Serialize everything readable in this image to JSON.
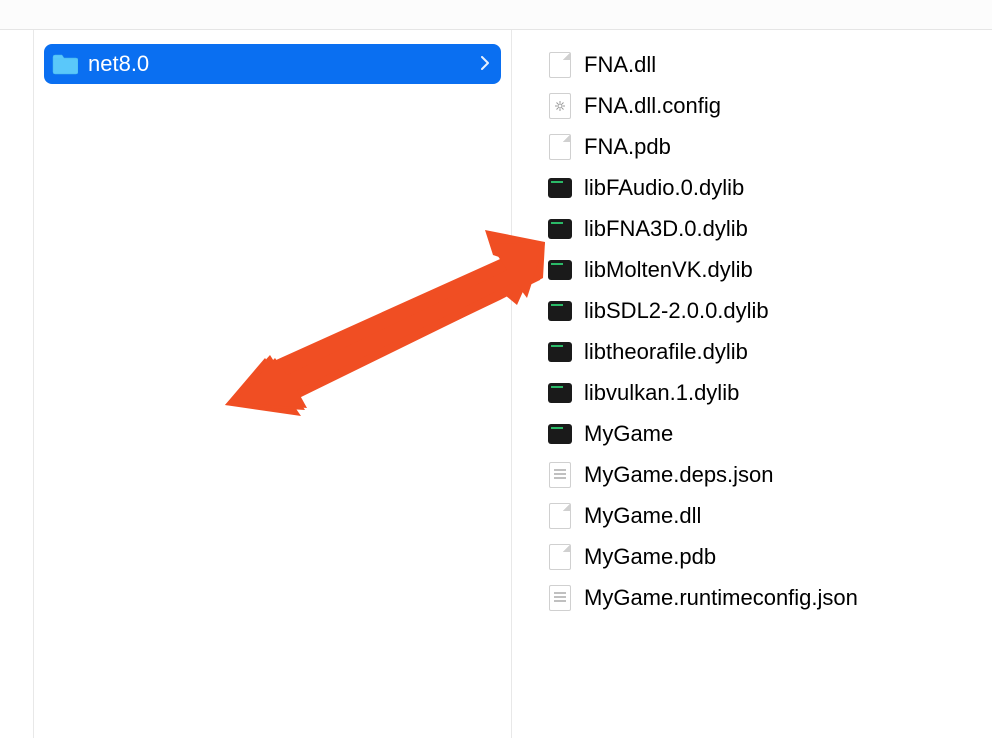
{
  "left_column": {
    "selected_folder": {
      "name": "net8.0",
      "icon": "folder"
    }
  },
  "right_column": {
    "files": [
      {
        "name": "FNA.dll",
        "icon": "blank"
      },
      {
        "name": "FNA.dll.config",
        "icon": "config"
      },
      {
        "name": "FNA.pdb",
        "icon": "blank"
      },
      {
        "name": "libFAudio.0.dylib",
        "icon": "exec"
      },
      {
        "name": "libFNA3D.0.dylib",
        "icon": "exec"
      },
      {
        "name": "libMoltenVK.dylib",
        "icon": "exec"
      },
      {
        "name": "libSDL2-2.0.0.dylib",
        "icon": "exec"
      },
      {
        "name": "libtheorafile.dylib",
        "icon": "exec"
      },
      {
        "name": "libvulkan.1.dylib",
        "icon": "exec"
      },
      {
        "name": "MyGame",
        "icon": "exec"
      },
      {
        "name": "MyGame.deps.json",
        "icon": "json"
      },
      {
        "name": "MyGame.dll",
        "icon": "blank"
      },
      {
        "name": "MyGame.pdb",
        "icon": "blank"
      },
      {
        "name": "MyGame.runtimeconfig.json",
        "icon": "json"
      }
    ]
  },
  "annotation": {
    "arrow_color": "#f04e23"
  }
}
